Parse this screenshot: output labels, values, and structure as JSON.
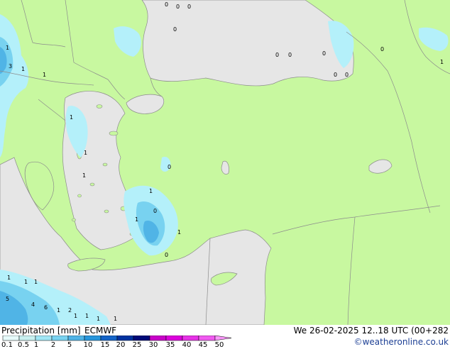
{
  "legend": {
    "title": "Precipitation [mm]",
    "model": "ECMWF",
    "ticks": [
      "0.1",
      "0.5",
      "1",
      "2",
      "5",
      "10",
      "15",
      "20",
      "25",
      "30",
      "35",
      "40",
      "45",
      "50"
    ],
    "colors": [
      "#e6fafa",
      "#c8f0f0",
      "#a0e6f5",
      "#78d2f0",
      "#50b4e6",
      "#2896dc",
      "#1464c8",
      "#0032a0",
      "#000a78",
      "#c800c8",
      "#dc00dc",
      "#e632e6",
      "#f05af0",
      "#fa96fa"
    ]
  },
  "header": {
    "datetime": "We 26-02-2025 12..18 UTC (00+282",
    "credit": "©weatheronline.co.uk"
  },
  "map": {
    "colors": {
      "land": "#c8f8a0",
      "sea": "#e6e6e6",
      "border": "#8c8c8c",
      "light_precip": "#b4f0fa",
      "medium_precip": "#78d2f0",
      "heavy_precip": "#50b4e6"
    },
    "labels": [
      "0",
      "0",
      "0",
      "0",
      "0",
      "0",
      "0",
      "0",
      "0",
      "0",
      "0",
      "0",
      "0",
      "1",
      "1",
      "1",
      "1",
      "1",
      "1",
      "1",
      "1",
      "1",
      "1",
      "1",
      "1",
      "1",
      "1",
      "1",
      "1",
      "1",
      "1",
      "2",
      "3",
      "4",
      "5",
      "6"
    ]
  }
}
